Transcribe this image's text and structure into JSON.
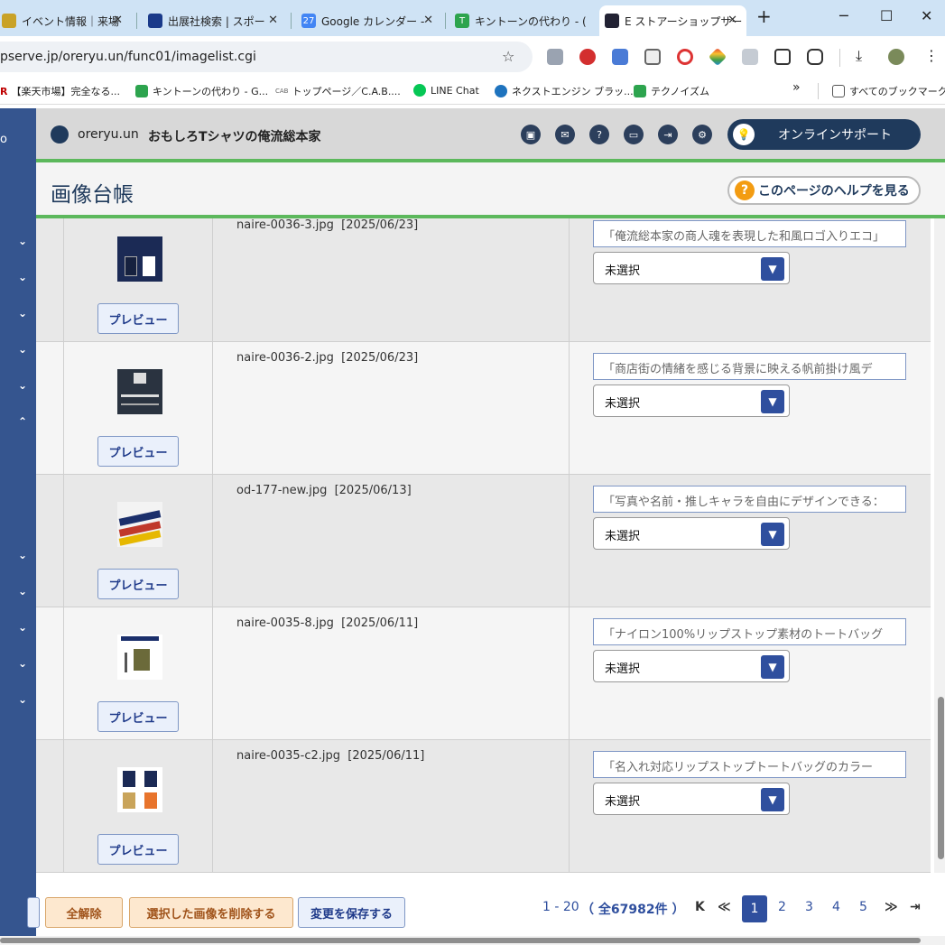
{
  "tabs": [
    {
      "label": "イベント情報｜来場",
      "fav_color": "#c9a227"
    },
    {
      "label": "出展社検索 | スポー",
      "fav_color": "#1a3a8a"
    },
    {
      "label": "Google カレンダー -",
      "fav_color": "#4285f4",
      "fav_text": "27"
    },
    {
      "label": "キントーンの代わり - (",
      "fav_color": "#2da44e",
      "fav_text": "T"
    },
    {
      "label": "E ストアーショップサー",
      "fav_color": "#223",
      "active": true
    }
  ],
  "address": {
    "url": "pserve.jp/oreryu.un/func01/imagelist.cgi"
  },
  "bookmarks": [
    {
      "label": "【楽天市場】完全なる...",
      "color": "#bf0000"
    },
    {
      "label": "キントーンの代わり - G...",
      "color": "#2da44e"
    },
    {
      "label": "トップページ／C.A.B....",
      "color": "#888"
    },
    {
      "label": "LINE Chat",
      "color": "#06c755"
    },
    {
      "label": "ネクストエンジン ブラッ...",
      "color": "#1e73be"
    },
    {
      "label": "テクノイズム",
      "color": "#2da44e"
    },
    {
      "label": "»",
      "color": ""
    },
    {
      "label": "すべてのブックマーク",
      "color": "#888"
    }
  ],
  "header": {
    "user": "oreryu.un",
    "shop_name": "おもしろTシャツの俺流総本家",
    "support_label": "オンラインサポート",
    "page_title": "画像台帳",
    "help_label": "このページのヘルプを見る"
  },
  "rows": [
    {
      "filename": "naire-0036-3.jpg",
      "date": "[2025/06/23]",
      "alt_text": "「俺流総本家の商人魂を表現した和風ロゴ入りエコ」",
      "select": "未選択",
      "preview": "プレビュー"
    },
    {
      "filename": "naire-0036-2.jpg",
      "date": "[2025/06/23]",
      "alt_text": "「商店街の情緒を感じる背景に映える帆前掛け風デ",
      "select": "未選択",
      "preview": "プレビュー"
    },
    {
      "filename": "od-177-new.jpg",
      "date": "[2025/06/13]",
      "alt_text": "「写真や名前・推しキャラを自由にデザインできる：",
      "select": "未選択",
      "preview": "プレビュー"
    },
    {
      "filename": "naire-0035-8.jpg",
      "date": "[2025/06/11]",
      "alt_text": "「ナイロン100%リップストップ素材のトートバッグ",
      "select": "未選択",
      "preview": "プレビュー"
    },
    {
      "filename": "naire-0035-c2.jpg",
      "date": "[2025/06/11]",
      "alt_text": "「名入れ対応リップストップトートバッグのカラー",
      "select": "未選択",
      "preview": "プレビュー"
    }
  ],
  "footer": {
    "clear_all": "全解除",
    "delete_selected": "選択した画像を削除する",
    "save_changes": "変更を保存する",
    "range": "1 - 20",
    "total": "（ 全67982件 ）",
    "pages": [
      "1",
      "2",
      "3",
      "4",
      "5"
    ],
    "current_page": "1"
  }
}
